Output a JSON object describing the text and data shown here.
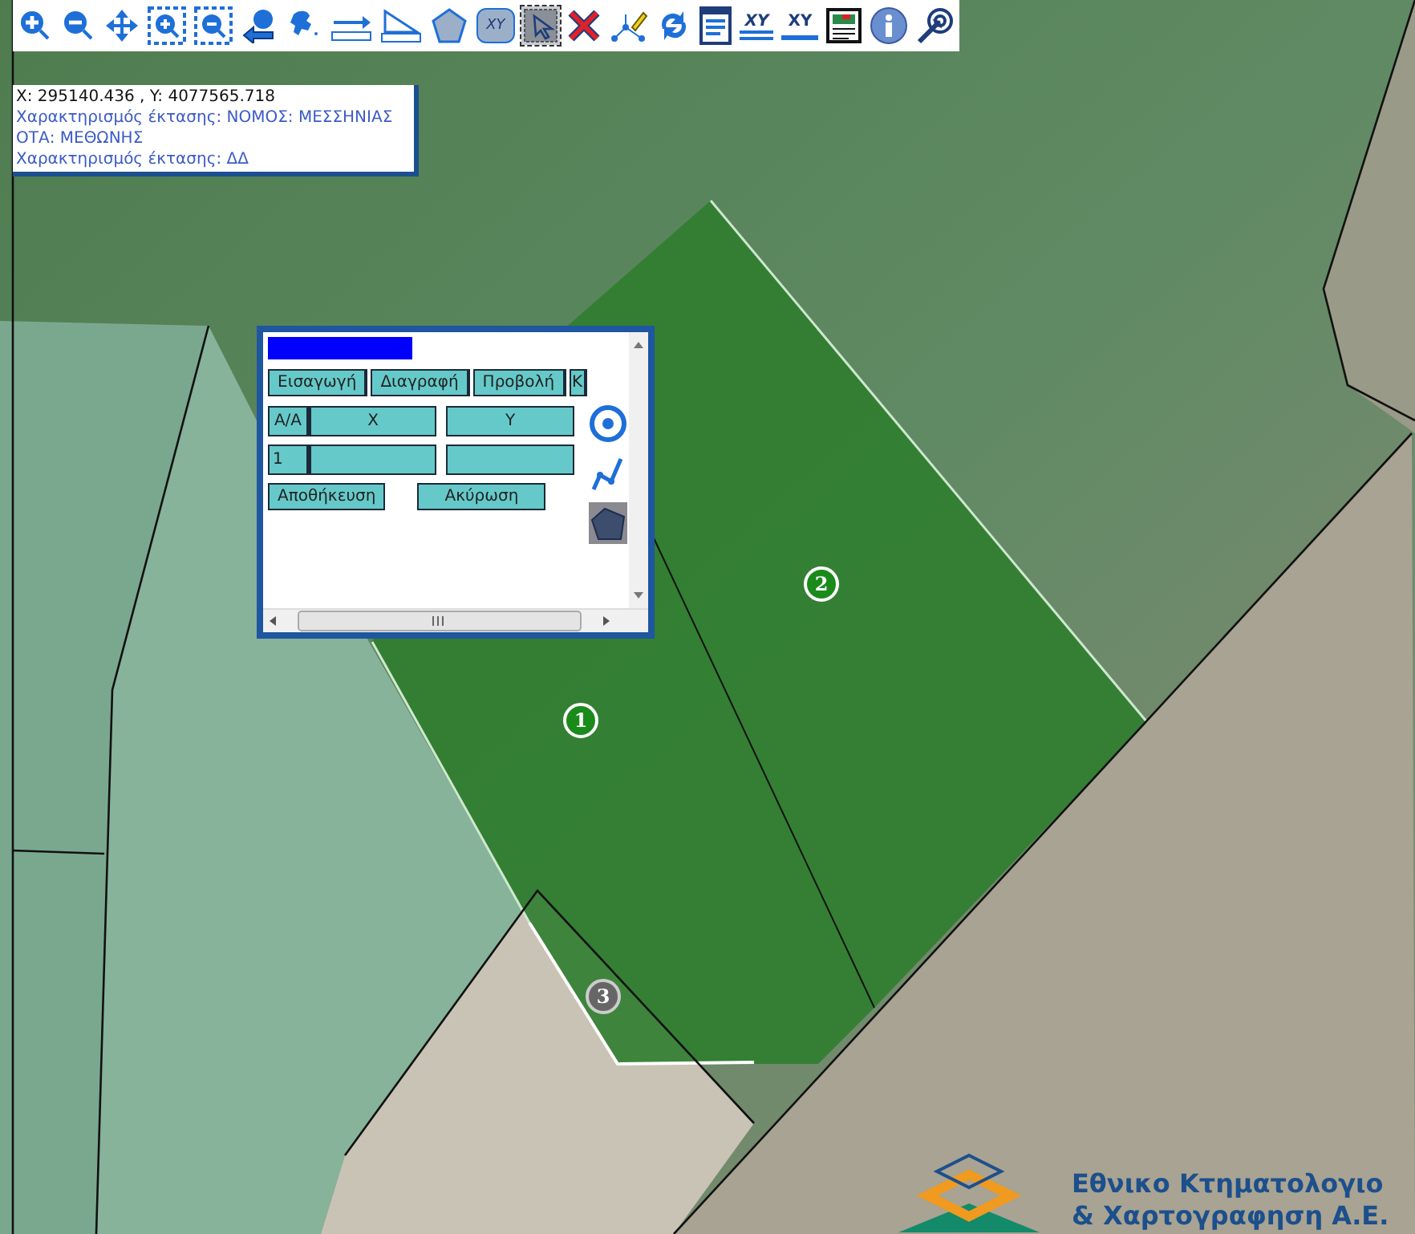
{
  "toolbar": {
    "tools": [
      {
        "kind": "zoom-in",
        "selected": false
      },
      {
        "kind": "zoom-out",
        "selected": false
      },
      {
        "kind": "pan",
        "selected": false
      },
      {
        "kind": "zoom-box-in",
        "selected": false
      },
      {
        "kind": "zoom-box-out",
        "selected": false
      },
      {
        "kind": "previous-extent",
        "selected": false
      },
      {
        "kind": "full-map",
        "selected": false
      },
      {
        "kind": "distance",
        "selected": false
      },
      {
        "kind": "area",
        "selected": false
      },
      {
        "kind": "polygon",
        "selected": false
      },
      {
        "kind": "xy-polygon",
        "label": "XY",
        "selected": false
      },
      {
        "kind": "select",
        "selected": true
      },
      {
        "kind": "delete",
        "selected": false
      },
      {
        "kind": "edit-vertex",
        "selected": false
      },
      {
        "kind": "refresh",
        "selected": false
      },
      {
        "kind": "document",
        "selected": false
      },
      {
        "kind": "xy-form",
        "label": "XY",
        "selected": false
      },
      {
        "kind": "xy-goto",
        "label": "XY",
        "selected": false
      },
      {
        "kind": "legend",
        "selected": false
      },
      {
        "kind": "info",
        "selected": false
      },
      {
        "kind": "locate",
        "selected": false
      }
    ]
  },
  "info_box": {
    "coordinates": "X: 295140.436 , Y: 4077565.718",
    "lines": [
      "Χαρακτηρισμός έκτασης: ΝΟΜΟΣ: ΜΕΣΣΗΝΙΑΣ",
      "ΟΤΑ: ΜΕΘΩΝΗΣ",
      "Χαρακτηρισμός έκτασης: ΔΔ"
    ]
  },
  "dialog": {
    "tabs": [
      "Εισαγωγή",
      "Διαγραφή",
      "Προβολή",
      "Κ"
    ],
    "table": {
      "columns": [
        "A/A",
        "X",
        "Y"
      ],
      "rows": [
        {
          "aa": "1"
        }
      ]
    },
    "buttons": [
      "Αποθήκευση",
      "Ακύρωση"
    ]
  },
  "map": {
    "parcels": [
      {
        "label": "1",
        "kind": "selected"
      },
      {
        "label": "2",
        "kind": "selected"
      },
      {
        "label": "3",
        "kind": "neighbor"
      }
    ]
  },
  "logo": {
    "lines": [
      "Εθνικο Κτηματολογιο",
      "& Χαρτογραφηση Α.Ε."
    ]
  }
}
